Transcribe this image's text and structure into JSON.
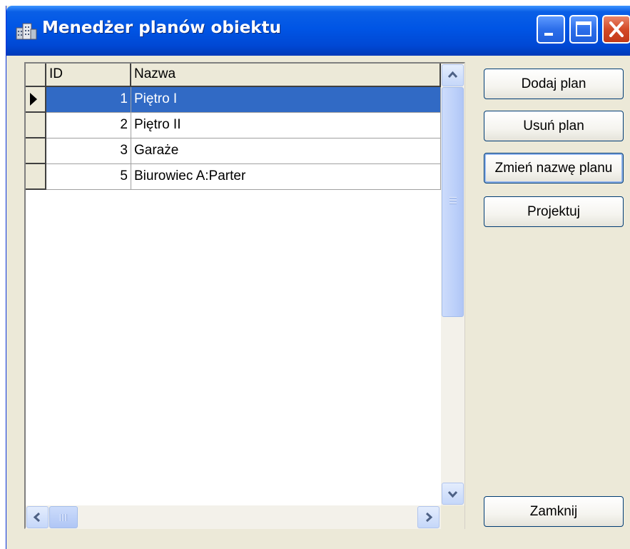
{
  "window": {
    "title": "Menedżer planów obiektu",
    "title_color": "#ffffff",
    "titlebar_color": "#0055e5"
  },
  "grid": {
    "columns": [
      "ID",
      "Nazwa"
    ],
    "rows": [
      {
        "id": "1",
        "name": "Piętro I",
        "selected": true
      },
      {
        "id": "2",
        "name": "Piętro II",
        "selected": false
      },
      {
        "id": "3",
        "name": "Garaże",
        "selected": false
      },
      {
        "id": "5",
        "name": "Biurowiec A:Parter",
        "selected": false
      }
    ],
    "selection_color": "#316ac5"
  },
  "buttons": {
    "add": "Dodaj plan",
    "delete": "Usuń plan",
    "rename": "Zmień nazwę planu",
    "design": "Projektuj",
    "close": "Zamknij"
  }
}
